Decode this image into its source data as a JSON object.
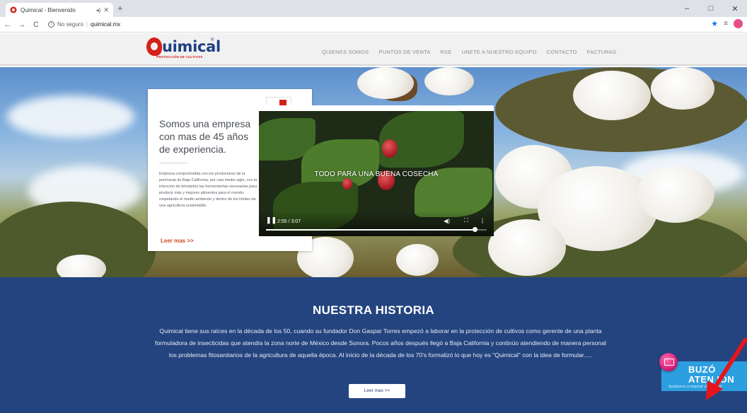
{
  "browser": {
    "tab_title": "Quimical - Bienvenido",
    "url_security": "No seguro",
    "url": "quimical.mx",
    "new_tab_glyph": "+",
    "back_glyph": "←",
    "forward_glyph": "→",
    "reload_glyph": "C",
    "star_glyph": "★",
    "list_glyph": "≡",
    "minimize_glyph": "–",
    "maximize_glyph": "□",
    "close_glyph": "✕"
  },
  "header": {
    "logo_text": "uimical",
    "logo_mark": "®",
    "logo_tagline": "PROTECCIÓN DE CULTIVOS",
    "nav": [
      "QUIENES SOMOS",
      "PUNTOS DE VENTA",
      "RSE",
      "UNETE A NUESTRO EQUIPO",
      "CONTACTO",
      "FACTURAS"
    ]
  },
  "hero_card": {
    "heading": "Somos una empresa con mas de 45 años de experiencia.",
    "body": "Empresa comprometida con los productores de la península de Baja California, por casi medio siglo, con la intención de brindarles las herramientas necesarias para producir más y mejores alimentos para el mundo, respetando el medio ambiente y dentro de los límites de una agricultura sustentable.",
    "link": "Leer mas >>"
  },
  "video": {
    "title": "TODO PARA UNA BUENA COSECHA",
    "time": "2:55 / 3:07",
    "progress": 0.946
  },
  "history": {
    "title": "NUESTRA HISTORIA",
    "text": "Quimical tiene sus raíces en la década de los 50, cuando su fundador Don Gaspar Torres empezó a laborar en la protección de cultivos como gerente de una planta formuladora de insecticidas que atendía la zona norte de México desde Sonora. Pocos años después llegó a Baja California y continúo atendiendo de manera personal los problemas fitosanitarios de la agricultura de aquella época. Al inicio de la década de los 70's formalizó lo que hoy es \"Quimical\" con la idea de formular.....",
    "button": "Leer mas >>"
  },
  "buzon": {
    "line1": "BUZÓ",
    "line2": "ATEN  ION",
    "subtitle": "Ayúdanos a mejorar ¡Contacta!"
  },
  "colors": {
    "brand_blue": "#24447f",
    "brand_red": "#d3211a",
    "buzon_blue": "#2c9fe0",
    "arrow_red": "#e8141b"
  },
  "icons": [
    "quimical-favicon",
    "info-icon",
    "star-icon",
    "reading-list-icon",
    "profile-icon",
    "pause-icon",
    "volume-icon",
    "fullscreen-icon",
    "more-icon",
    "mail-icon",
    "red-arrow"
  ]
}
